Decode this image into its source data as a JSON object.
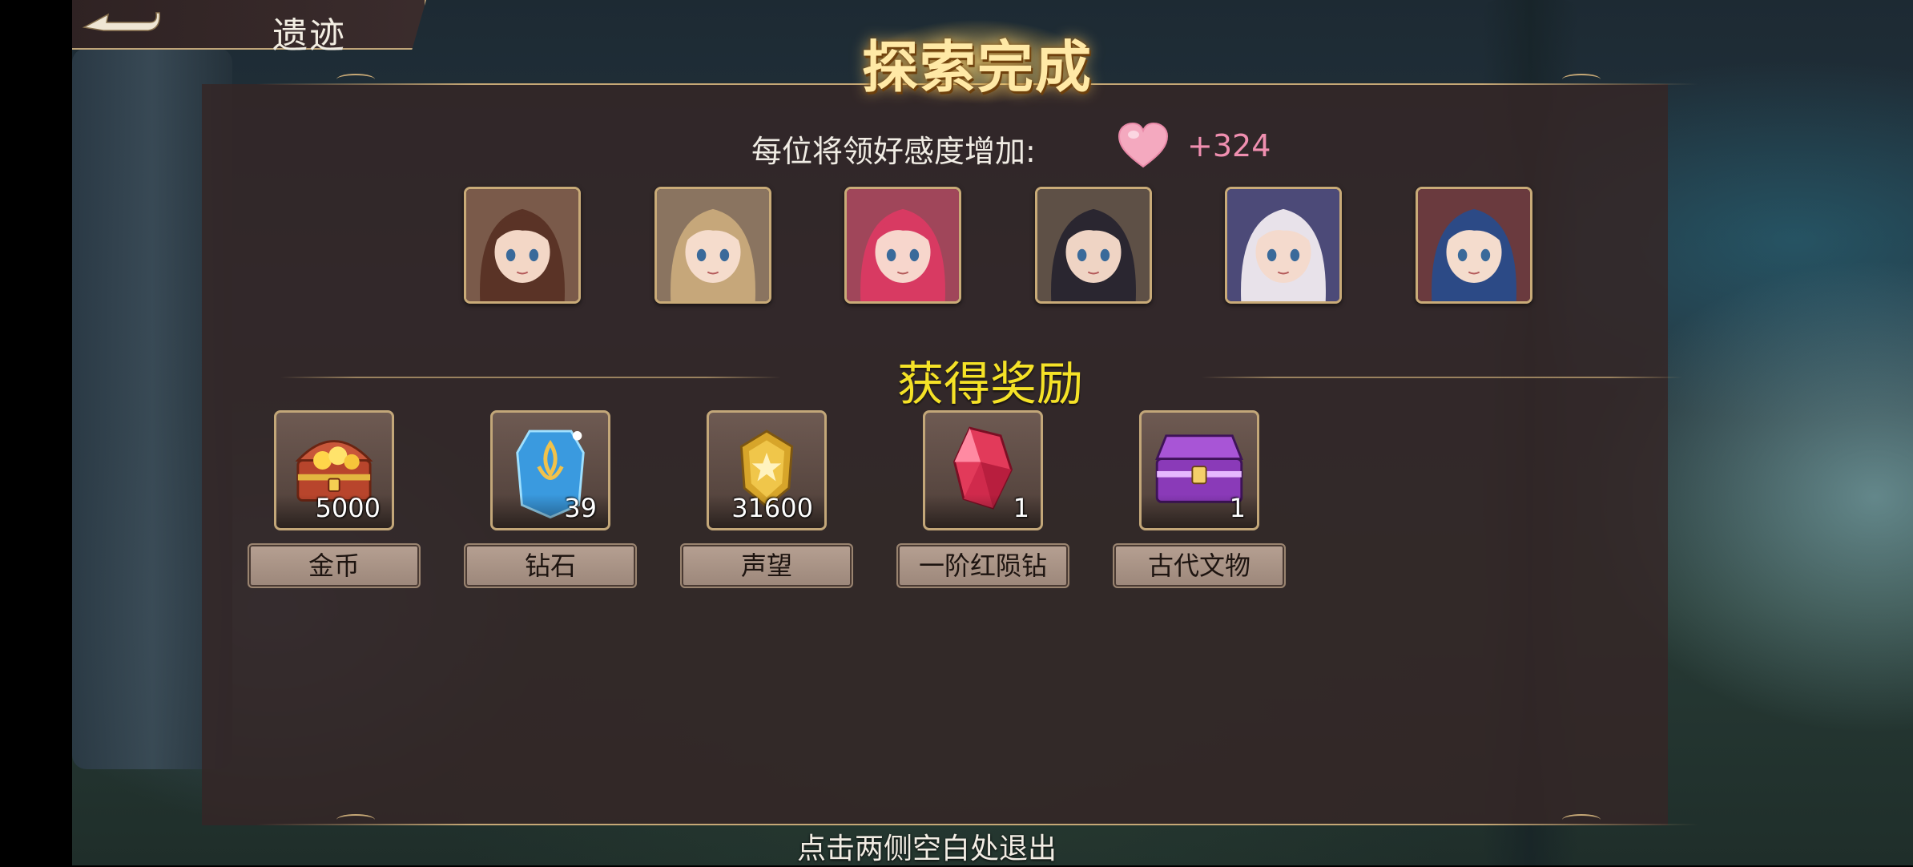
{
  "header": {
    "title": "遗迹"
  },
  "banner": {
    "title": "探索完成"
  },
  "affinity": {
    "label": "每位将领好感度增加:",
    "value": "+324"
  },
  "heroes": [
    {
      "name": "hero-portrait-1",
      "hair": "#5a3326",
      "skin": "#f3d7c6",
      "bg": "#7a5a4a"
    },
    {
      "name": "hero-portrait-2",
      "hair": "#c6a77a",
      "skin": "#f5dccc",
      "bg": "#8a7460"
    },
    {
      "name": "hero-portrait-3",
      "hair": "#d83a62",
      "skin": "#f7d6cc",
      "bg": "#a0465a"
    },
    {
      "name": "hero-portrait-4",
      "hair": "#2a2630",
      "skin": "#efd4c4",
      "bg": "#5e5046"
    },
    {
      "name": "hero-portrait-5",
      "hair": "#e8e2ea",
      "skin": "#f4dacd",
      "bg": "#4c4a78"
    },
    {
      "name": "hero-portrait-6",
      "hair": "#2c4a86",
      "skin": "#f4dccd",
      "bg": "#6a3a3e"
    }
  ],
  "rewards_title": "获得奖励",
  "rewards": [
    {
      "label": "金币",
      "count": "5000",
      "icon": "treasure-chest-icon"
    },
    {
      "label": "钻石",
      "count": "39",
      "icon": "diamond-crystal-icon"
    },
    {
      "label": "声望",
      "count": "31600",
      "icon": "reputation-badge-icon"
    },
    {
      "label": "一阶红陨钻",
      "count": "1",
      "icon": "red-gem-icon"
    },
    {
      "label": "古代文物",
      "count": "1",
      "icon": "purple-chest-icon"
    }
  ],
  "footer": {
    "exit_hint": "点击两侧空白处退出"
  },
  "colors": {
    "reward_title": "#f5e227",
    "affinity_value": "#f08fb0",
    "gold_trim": "#c6a876"
  }
}
